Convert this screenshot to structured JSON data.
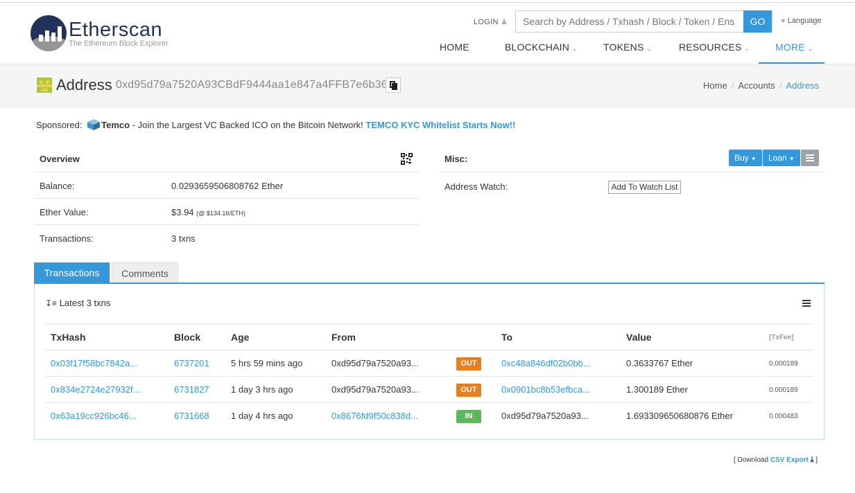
{
  "header": {
    "logo_title": "Etherscan",
    "logo_subtitle": "The Ethereum Block Explorer",
    "login": "LOGIN",
    "search_placeholder": "Search by Address / Txhash / Block / Token / Ens",
    "go": "GO",
    "language": "Language",
    "nav": [
      "HOME",
      "BLOCKCHAIN",
      "TOKENS",
      "RESOURCES",
      "MORE"
    ]
  },
  "page": {
    "title": "Address",
    "address": "0xd95d79a7520A93CBdF9444aa1e847a4FFB7e6b36",
    "breadcrumb": [
      "Home",
      "Accounts",
      "Address"
    ]
  },
  "sponsored": {
    "label": "Sponsored:",
    "brand": "Temco",
    "text": " - Join the Largest VC Backed ICO on the Bitcoin Network! ",
    "cta": "TEMCO KYC Whitelist Starts Now!!"
  },
  "overview": {
    "heading": "Overview",
    "balance_label": "Balance:",
    "balance_value": "0.0293659506808762 Ether",
    "ether_value_label": "Ether Value:",
    "ether_value": "$3.94",
    "ether_rate": "(@ $134.16/ETH)",
    "transactions_label": "Transactions:",
    "transactions_value": "3 txns"
  },
  "misc": {
    "heading": "Misc:",
    "buy": "Buy",
    "loan": "Loan",
    "watch_label": "Address Watch:",
    "watch_button": "Add To Watch List"
  },
  "tabs": [
    "Transactions",
    "Comments"
  ],
  "txns": {
    "latest": "Latest 3 txns",
    "columns": [
      "TxHash",
      "Block",
      "Age",
      "From",
      "To",
      "Value",
      "[TxFee]"
    ],
    "rows": [
      {
        "hash": "0x03f17f58bc7842a...",
        "block": "6737201",
        "age": "5 hrs 59 mins ago",
        "from": "0xd95d79a7520a93...",
        "dir": "OUT",
        "to": "0xc48a846df02b0bb...",
        "value": "0.3633767 Ether",
        "fee": "0.000189"
      },
      {
        "hash": "0x834e2724e27932f...",
        "block": "6731827",
        "age": "1 day 3 hrs ago",
        "from": "0xd95d79a7520a93...",
        "dir": "OUT",
        "to": "0x0901bc8b53efbca...",
        "value": "1.300189 Ether",
        "fee": "0.000189"
      },
      {
        "hash": "0x63a19cc926bc46...",
        "block": "6731668",
        "age": "1 day 4 hrs ago",
        "from": "0x8676fd9f50c838d...",
        "dir": "IN",
        "to": "0xd95d79a7520a93...",
        "value": "1.693309650680876 Ether",
        "fee": "0.000483"
      }
    ]
  },
  "csv": {
    "prefix": "[ Download ",
    "link": "CSV Export",
    "suffix": " ]"
  }
}
